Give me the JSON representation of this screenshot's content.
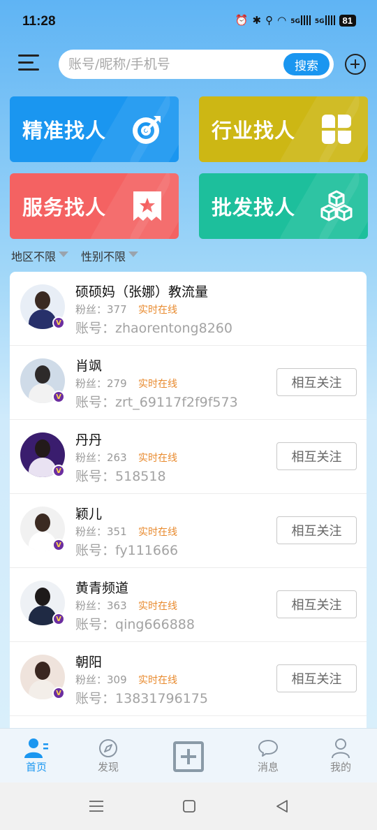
{
  "status": {
    "time": "11:28",
    "battery": "81",
    "net1": "5G",
    "net2": "5G"
  },
  "search": {
    "placeholder": "账号/昵称/手机号",
    "button": "搜索"
  },
  "categories": [
    {
      "label": "精准找人",
      "color": "#1a96f0",
      "icon": "target-icon"
    },
    {
      "label": "行业找人",
      "color": "#cdb714",
      "icon": "grid-petals-icon"
    },
    {
      "label": "服务找人",
      "color": "#f46262",
      "icon": "star-ticket-icon"
    },
    {
      "label": "批发找人",
      "color": "#1dbf9c",
      "icon": "boxes-icon"
    }
  ],
  "filters": {
    "region": "地区不限",
    "gender": "性别不限"
  },
  "labels": {
    "fans_prefix": "粉丝：",
    "account_prefix": "账号：",
    "online": "实时在线",
    "follow": "相互关注"
  },
  "users": [
    {
      "name": "硕硕妈（张娜）教流量",
      "fans": "377",
      "account": "zhaorentong8260"
    },
    {
      "name": "肖飒",
      "fans": "279",
      "account": "zrt_69117f2f9f573"
    },
    {
      "name": "丹丹",
      "fans": "263",
      "account": "518518"
    },
    {
      "name": "颖儿",
      "fans": "351",
      "account": "fy111666"
    },
    {
      "name": "黄青频道",
      "fans": "363",
      "account": "qing666888"
    },
    {
      "name": "朝阳",
      "fans": "309",
      "account": "13831796175"
    }
  ],
  "nav": {
    "home": "首页",
    "discover": "发现",
    "messages": "消息",
    "mine": "我的"
  },
  "colors": {
    "accent": "#1a96f0",
    "online": "#e88a2e",
    "vip_badge": "#6b2ea0"
  }
}
